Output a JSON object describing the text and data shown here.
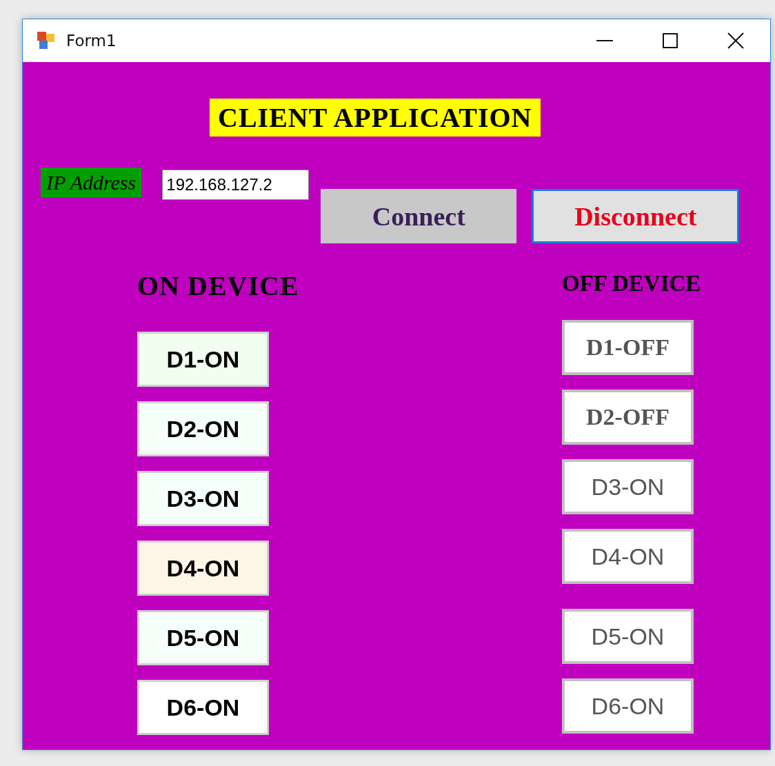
{
  "window": {
    "title": "Form1"
  },
  "heading": "CLIENT APPLICATION",
  "ip_label": "IP Address",
  "ip_field": {
    "value": "192.168.127.2"
  },
  "connect_buttons": [
    {
      "label": "Connect",
      "focused": false
    },
    {
      "label": "Disconnect",
      "focused": true
    }
  ],
  "on_section": {
    "title": "ON DEVICE",
    "buttons": [
      {
        "label": "D1-ON",
        "color": "#f0fff0"
      },
      {
        "label": "D2-ON",
        "color": "#f5fffa"
      },
      {
        "label": "D3-ON",
        "color": "#f5fffa"
      },
      {
        "label": "D4-ON",
        "color": "#fdf5e6"
      },
      {
        "label": "D5-ON",
        "color": "#f5fffa"
      },
      {
        "label": "D6-ON",
        "color": "#ffffff"
      }
    ]
  },
  "off_section": {
    "title": "OFF DEVICE",
    "buttons": [
      {
        "label": "D1-OFF",
        "kind": "serif"
      },
      {
        "label": "D2-OFF",
        "kind": "serif"
      },
      {
        "label": "D3-ON",
        "kind": "sans"
      },
      {
        "label": "D4-ON",
        "kind": "sans"
      },
      {
        "label": "D5-ON",
        "kind": "sans"
      },
      {
        "label": "D6-ON",
        "kind": "sans"
      }
    ]
  }
}
